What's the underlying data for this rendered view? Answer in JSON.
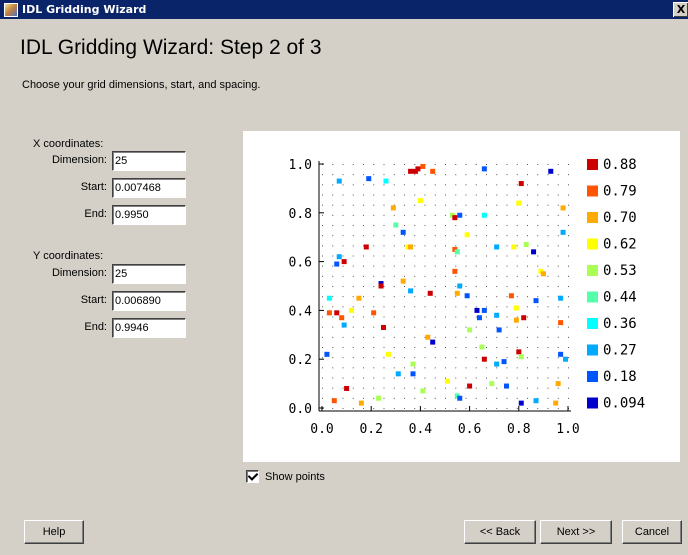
{
  "window": {
    "title": "IDL Gridding Wizard",
    "close_glyph": "X"
  },
  "heading": "IDL Gridding Wizard: Step 2 of 3",
  "instructions": "Choose your grid dimensions, start, and spacing.",
  "x_coords": {
    "label": "X coordinates:",
    "dimension_label": "Dimension:",
    "dimension": "25",
    "start_label": "Start:",
    "start": "0.007468",
    "end_label": "End:",
    "end": "0.9950"
  },
  "y_coords": {
    "label": "Y coordinates:",
    "dimension_label": "Dimension:",
    "dimension": "25",
    "start_label": "Start:",
    "start": "0.006890",
    "end_label": "End:",
    "end": "0.9946"
  },
  "show_points": {
    "label": "Show points",
    "checked": true
  },
  "buttons": {
    "help": "Help",
    "back": "<< Back",
    "next": "Next >>",
    "cancel": "Cancel"
  },
  "chart_data": {
    "type": "scatter",
    "xlim": [
      0,
      1
    ],
    "ylim": [
      0,
      1
    ],
    "x_ticks": [
      "0.0",
      "0.2",
      "0.4",
      "0.6",
      "0.8",
      "1.0"
    ],
    "y_ticks": [
      "0.0",
      "0.2",
      "0.4",
      "0.6",
      "0.8",
      "1.0"
    ],
    "grid_dots": 25,
    "legend": [
      {
        "label": "0.88",
        "color": "#cc0000"
      },
      {
        "label": "0.79",
        "color": "#ff5500"
      },
      {
        "label": "0.70",
        "color": "#ffaa00"
      },
      {
        "label": "0.62",
        "color": "#ffff00"
      },
      {
        "label": "0.53",
        "color": "#aaff55"
      },
      {
        "label": "0.44",
        "color": "#55ffaa"
      },
      {
        "label": "0.36",
        "color": "#00ffff"
      },
      {
        "label": "0.27",
        "color": "#00aaff"
      },
      {
        "label": "0.18",
        "color": "#0055ff"
      },
      {
        "label": "0.094",
        "color": "#0000cc"
      }
    ],
    "legend_position": "right",
    "points": [
      {
        "x": 0.36,
        "y": 0.97,
        "z": 0.88
      },
      {
        "x": 0.38,
        "y": 0.97,
        "z": 0.88
      },
      {
        "x": 0.39,
        "y": 0.98,
        "z": 0.88
      },
      {
        "x": 0.41,
        "y": 0.99,
        "z": 0.79
      },
      {
        "x": 0.45,
        "y": 0.97,
        "z": 0.79
      },
      {
        "x": 0.66,
        "y": 0.98,
        "z": 0.18
      },
      {
        "x": 0.81,
        "y": 0.92,
        "z": 0.88
      },
      {
        "x": 0.93,
        "y": 0.97,
        "z": 0.094
      },
      {
        "x": 0.07,
        "y": 0.93,
        "z": 0.27
      },
      {
        "x": 0.19,
        "y": 0.94,
        "z": 0.18
      },
      {
        "x": 0.26,
        "y": 0.93,
        "z": 0.36
      },
      {
        "x": 0.4,
        "y": 0.85,
        "z": 0.62
      },
      {
        "x": 0.8,
        "y": 0.84,
        "z": 0.62
      },
      {
        "x": 0.98,
        "y": 0.82,
        "z": 0.7
      },
      {
        "x": 0.29,
        "y": 0.82,
        "z": 0.7
      },
      {
        "x": 0.53,
        "y": 0.79,
        "z": 0.53
      },
      {
        "x": 0.54,
        "y": 0.78,
        "z": 0.88
      },
      {
        "x": 0.56,
        "y": 0.79,
        "z": 0.18
      },
      {
        "x": 0.66,
        "y": 0.79,
        "z": 0.36
      },
      {
        "x": 0.3,
        "y": 0.75,
        "z": 0.44
      },
      {
        "x": 0.33,
        "y": 0.72,
        "z": 0.18
      },
      {
        "x": 0.59,
        "y": 0.71,
        "z": 0.62
      },
      {
        "x": 0.71,
        "y": 0.66,
        "z": 0.27
      },
      {
        "x": 0.78,
        "y": 0.66,
        "z": 0.62
      },
      {
        "x": 0.83,
        "y": 0.67,
        "z": 0.53
      },
      {
        "x": 0.86,
        "y": 0.64,
        "z": 0.094
      },
      {
        "x": 0.98,
        "y": 0.72,
        "z": 0.27
      },
      {
        "x": 0.18,
        "y": 0.66,
        "z": 0.88
      },
      {
        "x": 0.35,
        "y": 0.66,
        "z": 0.62
      },
      {
        "x": 0.36,
        "y": 0.66,
        "z": 0.7
      },
      {
        "x": 0.54,
        "y": 0.65,
        "z": 0.79
      },
      {
        "x": 0.55,
        "y": 0.64,
        "z": 0.44
      },
      {
        "x": 0.07,
        "y": 0.62,
        "z": 0.27
      },
      {
        "x": 0.06,
        "y": 0.59,
        "z": 0.18
      },
      {
        "x": 0.09,
        "y": 0.6,
        "z": 0.88
      },
      {
        "x": 0.54,
        "y": 0.56,
        "z": 0.79
      },
      {
        "x": 0.89,
        "y": 0.56,
        "z": 0.62
      },
      {
        "x": 0.9,
        "y": 0.55,
        "z": 0.7
      },
      {
        "x": 0.24,
        "y": 0.51,
        "z": 0.094
      },
      {
        "x": 0.24,
        "y": 0.5,
        "z": 0.88
      },
      {
        "x": 0.33,
        "y": 0.52,
        "z": 0.7
      },
      {
        "x": 0.36,
        "y": 0.48,
        "z": 0.27
      },
      {
        "x": 0.44,
        "y": 0.47,
        "z": 0.88
      },
      {
        "x": 0.56,
        "y": 0.5,
        "z": 0.27
      },
      {
        "x": 0.55,
        "y": 0.47,
        "z": 0.7
      },
      {
        "x": 0.59,
        "y": 0.46,
        "z": 0.18
      },
      {
        "x": 0.63,
        "y": 0.4,
        "z": 0.094
      },
      {
        "x": 0.66,
        "y": 0.4,
        "z": 0.18
      },
      {
        "x": 0.64,
        "y": 0.37,
        "z": 0.18
      },
      {
        "x": 0.71,
        "y": 0.38,
        "z": 0.27
      },
      {
        "x": 0.79,
        "y": 0.36,
        "z": 0.7
      },
      {
        "x": 0.82,
        "y": 0.37,
        "z": 0.88
      },
      {
        "x": 0.79,
        "y": 0.41,
        "z": 0.62
      },
      {
        "x": 0.77,
        "y": 0.46,
        "z": 0.79
      },
      {
        "x": 0.87,
        "y": 0.44,
        "z": 0.18
      },
      {
        "x": 0.97,
        "y": 0.45,
        "z": 0.27
      },
      {
        "x": 0.97,
        "y": 0.35,
        "z": 0.79
      },
      {
        "x": 0.03,
        "y": 0.45,
        "z": 0.36
      },
      {
        "x": 0.15,
        "y": 0.45,
        "z": 0.7
      },
      {
        "x": 0.03,
        "y": 0.39,
        "z": 0.79
      },
      {
        "x": 0.06,
        "y": 0.39,
        "z": 0.88
      },
      {
        "x": 0.08,
        "y": 0.37,
        "z": 0.79
      },
      {
        "x": 0.09,
        "y": 0.34,
        "z": 0.27
      },
      {
        "x": 0.12,
        "y": 0.4,
        "z": 0.62
      },
      {
        "x": 0.21,
        "y": 0.39,
        "z": 0.79
      },
      {
        "x": 0.25,
        "y": 0.33,
        "z": 0.88
      },
      {
        "x": 0.6,
        "y": 0.32,
        "z": 0.53
      },
      {
        "x": 0.72,
        "y": 0.32,
        "z": 0.18
      },
      {
        "x": 0.43,
        "y": 0.29,
        "z": 0.7
      },
      {
        "x": 0.45,
        "y": 0.27,
        "z": 0.094
      },
      {
        "x": 0.65,
        "y": 0.25,
        "z": 0.53
      },
      {
        "x": 0.66,
        "y": 0.2,
        "z": 0.88
      },
      {
        "x": 0.71,
        "y": 0.18,
        "z": 0.27
      },
      {
        "x": 0.74,
        "y": 0.19,
        "z": 0.18
      },
      {
        "x": 0.8,
        "y": 0.23,
        "z": 0.88
      },
      {
        "x": 0.81,
        "y": 0.21,
        "z": 0.53
      },
      {
        "x": 0.97,
        "y": 0.22,
        "z": 0.18
      },
      {
        "x": 0.99,
        "y": 0.2,
        "z": 0.27
      },
      {
        "x": 0.02,
        "y": 0.22,
        "z": 0.18
      },
      {
        "x": 0.27,
        "y": 0.22,
        "z": 0.62
      },
      {
        "x": 0.37,
        "y": 0.18,
        "z": 0.53
      },
      {
        "x": 0.31,
        "y": 0.14,
        "z": 0.27
      },
      {
        "x": 0.37,
        "y": 0.14,
        "z": 0.18
      },
      {
        "x": 0.51,
        "y": 0.11,
        "z": 0.62
      },
      {
        "x": 0.6,
        "y": 0.09,
        "z": 0.88
      },
      {
        "x": 0.69,
        "y": 0.1,
        "z": 0.53
      },
      {
        "x": 0.75,
        "y": 0.09,
        "z": 0.18
      },
      {
        "x": 0.96,
        "y": 0.1,
        "z": 0.7
      },
      {
        "x": 0.1,
        "y": 0.08,
        "z": 0.88
      },
      {
        "x": 0.41,
        "y": 0.07,
        "z": 0.53
      },
      {
        "x": 0.55,
        "y": 0.05,
        "z": 0.44
      },
      {
        "x": 0.56,
        "y": 0.04,
        "z": 0.18
      },
      {
        "x": 0.05,
        "y": 0.03,
        "z": 0.79
      },
      {
        "x": 0.16,
        "y": 0.02,
        "z": 0.7
      },
      {
        "x": 0.23,
        "y": 0.04,
        "z": 0.53
      },
      {
        "x": 0.81,
        "y": 0.02,
        "z": 0.094
      },
      {
        "x": 0.87,
        "y": 0.03,
        "z": 0.27
      },
      {
        "x": 0.95,
        "y": 0.02,
        "z": 0.7
      }
    ]
  }
}
